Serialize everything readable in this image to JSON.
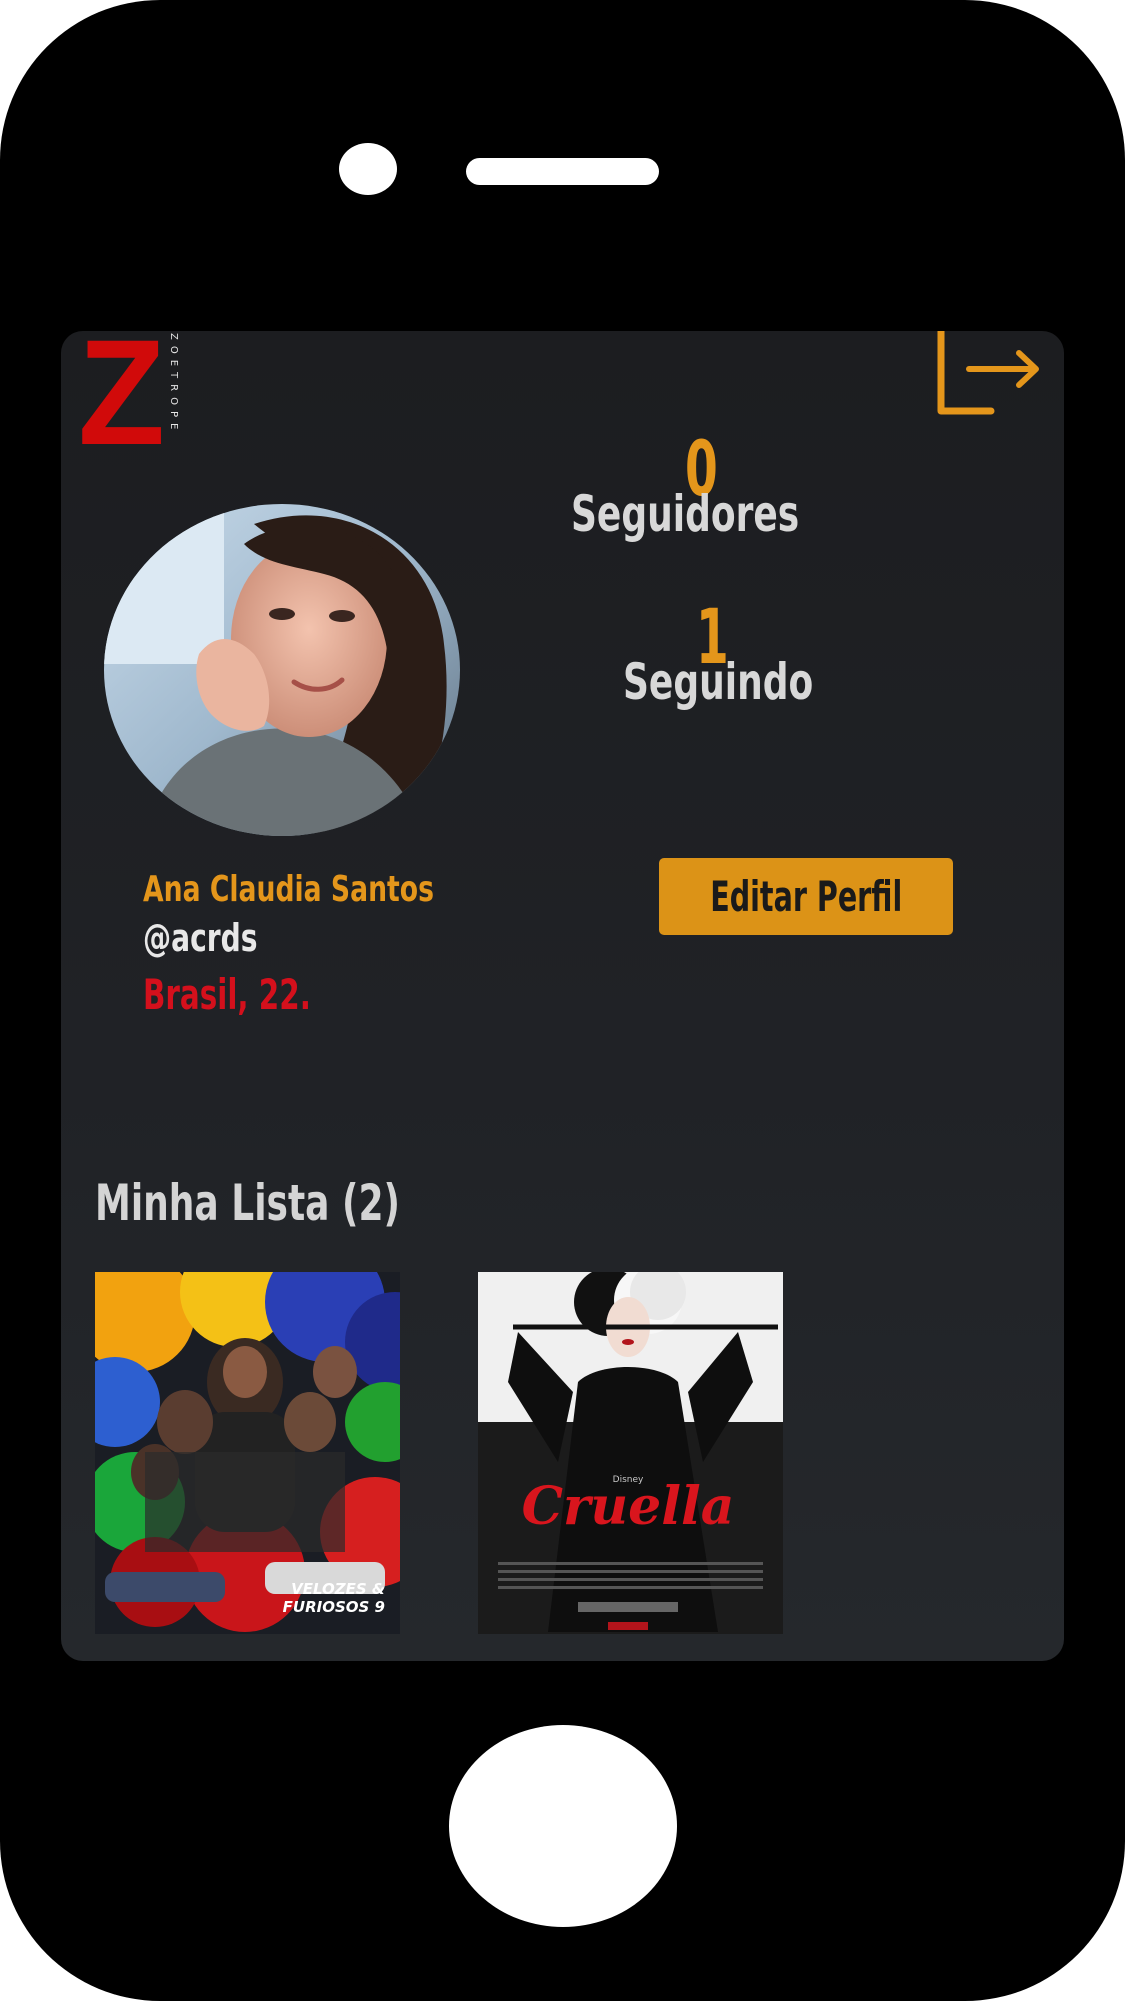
{
  "app": {
    "logo_letter": "Z",
    "logo_word": "ZOETROPE"
  },
  "profile": {
    "name": "Ana Claudia Santos",
    "handle": "@acrds",
    "location": "Brasil, 22.",
    "edit_label": "Editar Perfil"
  },
  "stats": {
    "followers_count": "0",
    "followers_label": "Seguidores",
    "following_count": "1",
    "following_label": "Seguindo"
  },
  "my_list": {
    "title": "Minha Lista (2)",
    "items": [
      {
        "title": "VELOZES & FURIOSOS 9"
      },
      {
        "title": "Cruella"
      }
    ]
  },
  "icons": {
    "logout": "logout-icon"
  },
  "colors": {
    "accent": "#e4961b",
    "brand_red": "#d10a0a",
    "location_red": "#d4101c",
    "screen_bg": "#1f2024"
  }
}
